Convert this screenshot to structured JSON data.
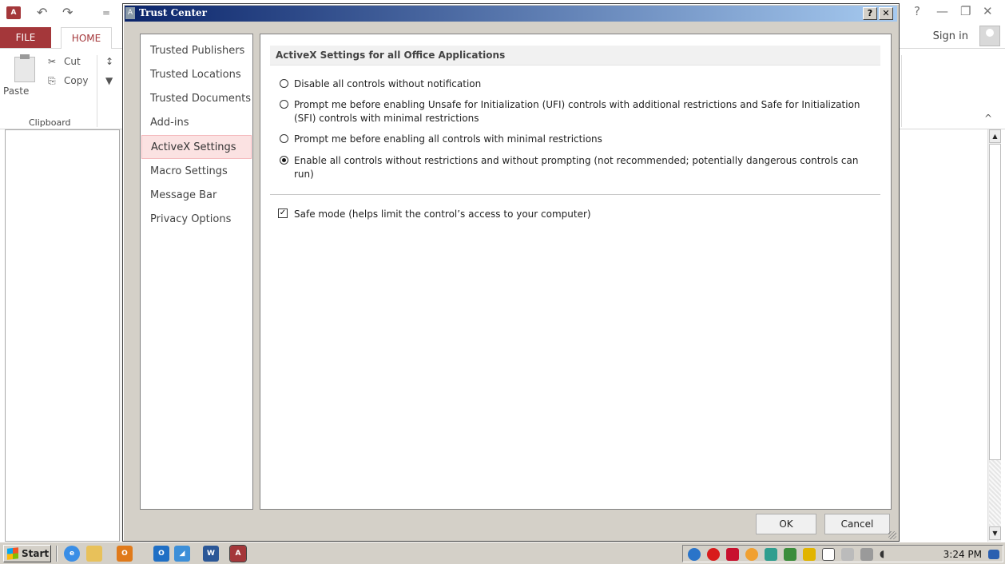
{
  "access": {
    "icon_text": "A",
    "qat": [
      "↶",
      "↷",
      "="
    ],
    "window_controls": [
      "?",
      "—",
      "❐",
      "✕"
    ],
    "tabs": {
      "file": "FILE",
      "home": "HOME"
    },
    "sign_in": "Sign in",
    "ribbon": {
      "paste": "Paste",
      "cut": "Cut",
      "copy": "Copy",
      "group_clipboard": "Clipboard",
      "collapse": "^"
    }
  },
  "dialog": {
    "title": "Trust Center",
    "help_button": "?",
    "close_button": "✕",
    "nav_items": [
      {
        "label": "Trusted Publishers",
        "selected": false
      },
      {
        "label": "Trusted Locations",
        "selected": false
      },
      {
        "label": "Trusted Documents",
        "selected": false
      },
      {
        "label": "Add-ins",
        "selected": false
      },
      {
        "label": "ActiveX Settings",
        "selected": true
      },
      {
        "label": "Macro Settings",
        "selected": false
      },
      {
        "label": "Message Bar",
        "selected": false
      },
      {
        "label": "Privacy Options",
        "selected": false
      }
    ],
    "section_title": "ActiveX Settings for all Office Applications",
    "options": [
      {
        "label": "Disable all controls without notification",
        "checked": false
      },
      {
        "label": "Prompt me before enabling Unsafe for Initialization (UFI) controls with additional restrictions and Safe for Initialization (SFI) controls with minimal restrictions",
        "checked": false
      },
      {
        "label": "Prompt me before enabling all controls with minimal restrictions",
        "checked": false
      },
      {
        "label": "Enable all controls without restrictions and without prompting (not recommended; potentially dangerous controls can run)",
        "checked": true
      }
    ],
    "safe_mode": {
      "label": "Safe mode (helps limit the control’s access to your computer)",
      "checked": true
    },
    "ok": "OK",
    "cancel": "Cancel"
  },
  "taskbar": {
    "start": "Start",
    "clock": "3:24 PM",
    "icon_names": [
      "ie-icon",
      "folder-icon",
      "outlook-icon",
      "outlook-mail-icon",
      "media-player-icon",
      "word-icon",
      "access-icon"
    ]
  },
  "colors": {
    "access_accent": "#a4373a",
    "dialog_face": "#d4d0c8",
    "titlebar_start": "#0a246a",
    "titlebar_end": "#a6caf0",
    "selected_nav": "#fbe2e2"
  }
}
